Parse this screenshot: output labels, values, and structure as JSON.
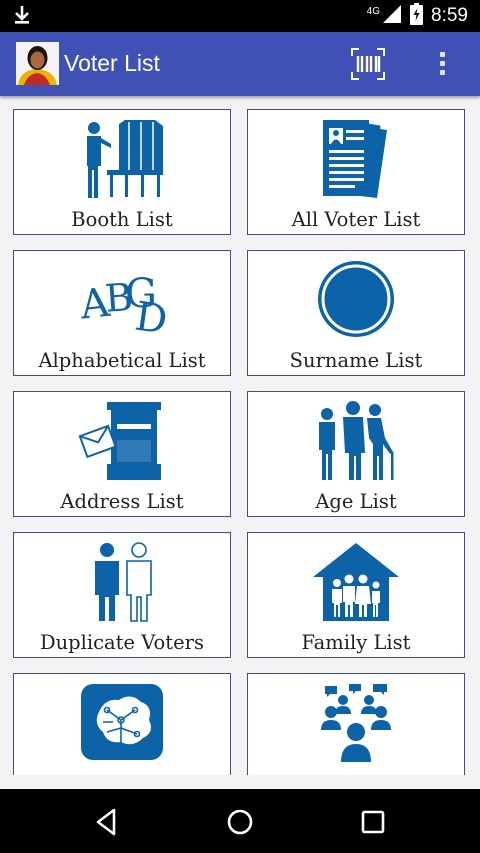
{
  "status_bar": {
    "network": "4G",
    "time": "8:59",
    "icons": [
      "download-icon",
      "signal-icon",
      "battery-icon"
    ]
  },
  "app_bar": {
    "title": "Voter List",
    "color": "#3f51b5",
    "icons": [
      "avatar",
      "barcode-scan-icon",
      "overflow-menu-icon"
    ]
  },
  "tiles": [
    {
      "label": "Booth List",
      "icon": "voting-booth-icon"
    },
    {
      "label": "All Voter List",
      "icon": "documents-icon"
    },
    {
      "label": "Alphabetical List",
      "icon": "abcd-letters-icon"
    },
    {
      "label": "Surname List",
      "icon": "circle-icon"
    },
    {
      "label": "Address List",
      "icon": "mailbox-icon"
    },
    {
      "label": "Age List",
      "icon": "age-group-icon"
    },
    {
      "label": "Duplicate Voters",
      "icon": "duplicate-person-icon"
    },
    {
      "label": "Family List",
      "icon": "family-house-icon"
    },
    {
      "label": "",
      "icon": "map-region-icon"
    },
    {
      "label": "",
      "icon": "group-discussion-icon"
    }
  ],
  "theme": {
    "icon_color": "#0d63a8",
    "tile_border": "#46489b"
  },
  "nav_bar": {
    "icons": [
      "back-icon",
      "home-icon",
      "recents-icon"
    ]
  }
}
